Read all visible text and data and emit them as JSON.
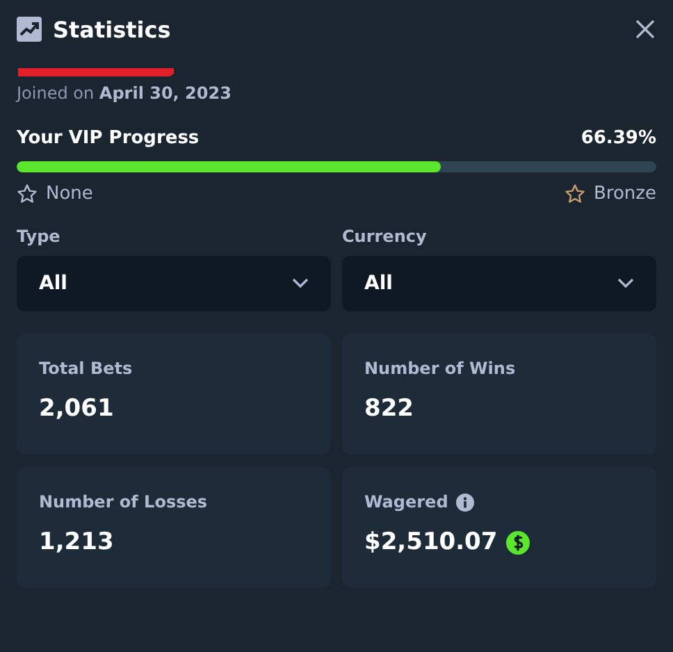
{
  "header": {
    "title": "Statistics"
  },
  "profile": {
    "joined": "Joined on **April 30, 2023**"
  },
  "vip": {
    "label": "Your VIP Progress",
    "reading": "66.39%",
    "level": 0.6639,
    "ranks": [
      {
        "name": "None",
        "color": "#b1bad3"
      },
      {
        "name": "Bronze",
        "color": "#c69c6d"
      }
    ]
  },
  "filters": [
    {
      "label": "Type",
      "value": "All"
    },
    {
      "label": "Currency",
      "value": "All"
    }
  ],
  "stats": [
    {
      "label": "Total Bets",
      "value": "2,061",
      "kind": "plain"
    },
    {
      "label": "Number of Wins",
      "value": "822",
      "kind": "plain"
    },
    {
      "label": "Number of Losses",
      "value": "1,213",
      "kind": "plain"
    },
    {
      "label": "Wagered",
      "value": "$2,510.07",
      "kind": "money"
    }
  ]
}
